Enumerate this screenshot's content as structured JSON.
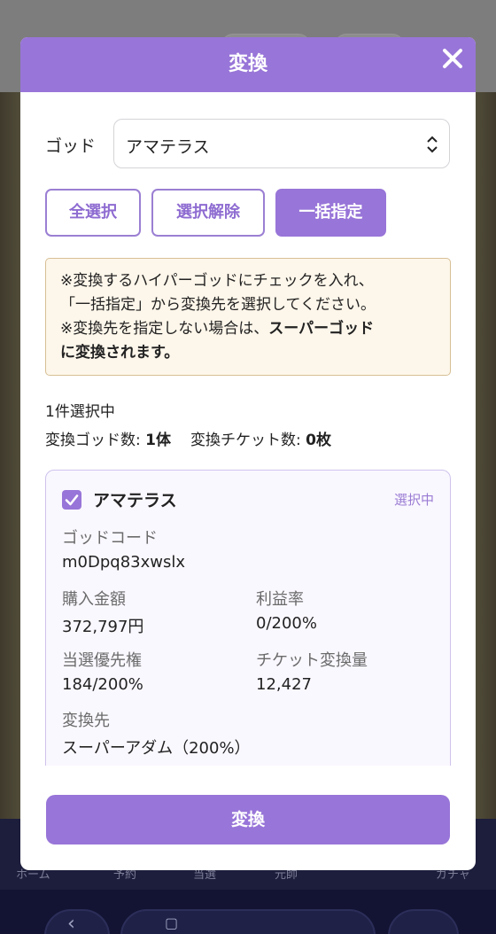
{
  "background": {
    "nav_labels": [
      "ホーム",
      "予約",
      "当選",
      "元帥",
      "",
      "ガチャ"
    ]
  },
  "modal": {
    "title": "変換",
    "god_label": "ゴッド",
    "god_select": {
      "selected": "アマテラス"
    },
    "buttons": {
      "select_all": "全選択",
      "deselect": "選択解除",
      "bulk_assign": "一括指定"
    },
    "notice": {
      "line1": "※変換するハイパーゴッドにチェックを入れ、",
      "line2": "「一括指定」から変換先を選択してください。",
      "line3_prefix": "※変換先を指定しない場合は、",
      "line3_bold": "スーパーゴッド",
      "line4_bold": "に変換されます。"
    },
    "selected_count": "1件選択中",
    "summary": {
      "god_count_label": "変換ゴッド数:",
      "god_count_value": "1体",
      "ticket_count_label": "変換チケット数:",
      "ticket_count_value": "0枚"
    },
    "card": {
      "checked": true,
      "name": "アマテラス",
      "badge": "選択中",
      "god_code_label": "ゴッドコード",
      "god_code": "m0Dpq83xwslx",
      "purchase_label": "購入金額",
      "purchase": "372,797円",
      "profit_label": "利益率",
      "profit": "0/200%",
      "priority_label": "当選優先権",
      "priority": "184/200%",
      "ticket_label": "チケット変換量",
      "ticket": "12,427",
      "target_label": "変換先",
      "target": "スーパーアダム（200%）"
    },
    "convert_button": "変換"
  },
  "colors": {
    "accent": "#9875d8",
    "notice_bg": "#fdf6ea",
    "notice_border": "#d7bf95",
    "card_bg": "#faf8ff"
  },
  "icons": {
    "close": "close-icon",
    "select_arrow": "updown-chevron-icon",
    "checkbox": "checkmark-icon"
  }
}
